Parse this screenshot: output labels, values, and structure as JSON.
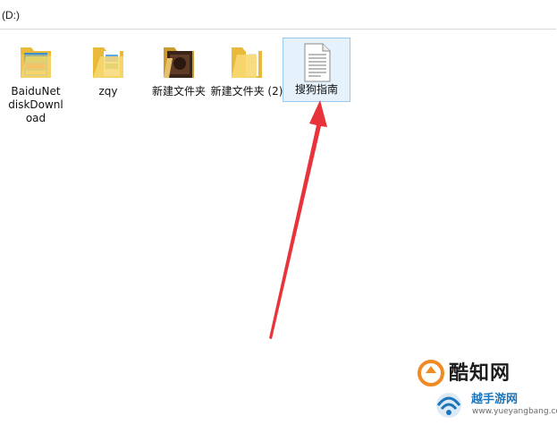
{
  "address_bar": {
    "path": "(D:)"
  },
  "files": [
    {
      "name": "BaiduNet diskDownl oad",
      "type": "folder",
      "icon": "folder-colorful-icon"
    },
    {
      "name": "zqy",
      "type": "folder",
      "icon": "folder-colorful-icon"
    },
    {
      "name": "新建文件夹",
      "type": "folder",
      "icon": "folder-dark-image-icon"
    },
    {
      "name": "新建文件夹 (2)",
      "type": "folder",
      "icon": "folder-plain-icon"
    },
    {
      "name": "搜狗指南",
      "type": "document",
      "icon": "text-document-icon",
      "selected": true
    }
  ],
  "annotation": {
    "arrow_color": "#e8333a",
    "arrow_target": "搜狗指南"
  },
  "watermark": {
    "brand_top": "酷知网",
    "brand_bottom": "越手游网",
    "url": "www.yueyangbang.com",
    "colors": {
      "orange": "#f08a24",
      "blue": "#1b75bb"
    }
  }
}
